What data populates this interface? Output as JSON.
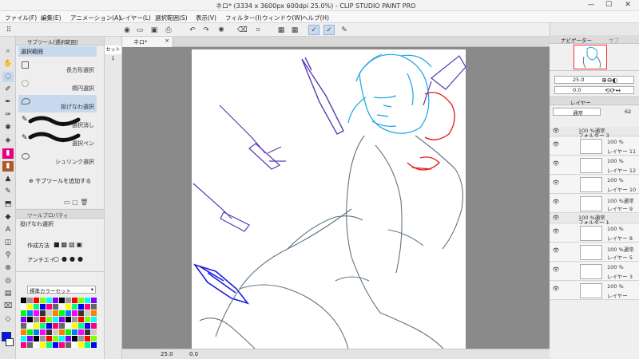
{
  "window": {
    "title": "ネロ* (3334 x 3600px 600dpi 25.0%)  - CLIP STUDIO PAINT PRO",
    "minimize": "—",
    "maximize": "☐",
    "close": "✕"
  },
  "menu": [
    "ファイル(F)",
    "編集(E)",
    "アニメーション(A)",
    "レイヤー(L)",
    "選択範囲(S)",
    "表示(V)",
    "フィルター(I)",
    "ウィンドウ(W)",
    "ヘルプ(H)"
  ],
  "sub_tool_panel": {
    "header": "サブツール[選択範囲]",
    "group_label": "選択範囲",
    "set_tab": "セット1",
    "items": [
      {
        "label": "長方形選択",
        "selected": false
      },
      {
        "label": "楕円選択",
        "selected": false
      },
      {
        "label": "投げなわ選択",
        "selected": true
      },
      {
        "label": "選択消し",
        "selected": false
      },
      {
        "label": "選択ペン",
        "selected": false
      },
      {
        "label": "シュリンク選択",
        "selected": false
      }
    ],
    "add_button": "サブツールを追加する"
  },
  "tool_property": {
    "header": "ツールプロパティ",
    "tool_name": "投げなわ選択",
    "creation_method": "作成方法",
    "antialias": "アンチエイ"
  },
  "color_set": {
    "dropdown": "標準カラーセット"
  },
  "document_tab": "ネロ*",
  "status": {
    "zoom": "25.0",
    "angle": "0.0"
  },
  "right_panel": {
    "navigator_tab": "ナビゲーター",
    "second_tab": "サブ",
    "zoom": "25.0",
    "angle": "0.0",
    "layer_tab": "レイヤー",
    "blend_mode": "通常",
    "opacity": "62",
    "layers": [
      {
        "kind": "folder",
        "percent": "100 %通常",
        "name": "フォルダー 3"
      },
      {
        "kind": "layer",
        "percent": "100 %",
        "name": "レイヤー 11"
      },
      {
        "kind": "layer",
        "percent": "100 %",
        "name": "レイヤー 12"
      },
      {
        "kind": "layer",
        "percent": "100 %",
        "name": "レイヤー 10"
      },
      {
        "kind": "layer",
        "percent": "100 %通常",
        "name": "レイヤー 9"
      },
      {
        "kind": "folder",
        "percent": "100 %通常",
        "name": "フォルダー 1"
      },
      {
        "kind": "layer",
        "percent": "100 %",
        "name": "レイヤー 8"
      },
      {
        "kind": "layer",
        "percent": "100 %通常",
        "name": "レイヤー 5"
      },
      {
        "kind": "layer",
        "percent": "100 %",
        "name": "レイヤー 3"
      },
      {
        "kind": "layer",
        "percent": "100 %",
        "name": "レイヤー"
      }
    ]
  },
  "colors": {
    "main_color": "#0014ff",
    "sub_color": "#ffffff",
    "selection_highlight": "#c7d9ee",
    "sketch_blue": "#1aa3e8",
    "sketch_purple": "#5a3ab4",
    "sketch_red": "#e01818",
    "sketch_gray": "#5f7480"
  }
}
